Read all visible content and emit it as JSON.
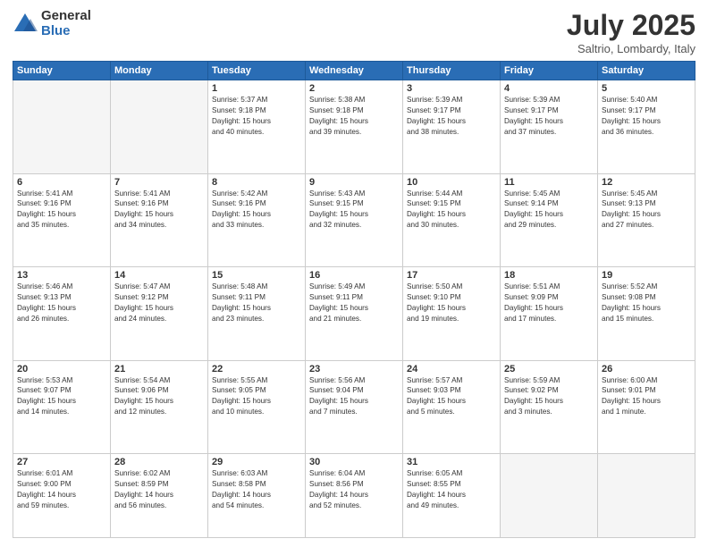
{
  "header": {
    "logo_general": "General",
    "logo_blue": "Blue",
    "month_title": "July 2025",
    "location": "Saltrio, Lombardy, Italy"
  },
  "days_of_week": [
    "Sunday",
    "Monday",
    "Tuesday",
    "Wednesday",
    "Thursday",
    "Friday",
    "Saturday"
  ],
  "weeks": [
    [
      {
        "day": "",
        "info": ""
      },
      {
        "day": "",
        "info": ""
      },
      {
        "day": "1",
        "info": "Sunrise: 5:37 AM\nSunset: 9:18 PM\nDaylight: 15 hours\nand 40 minutes."
      },
      {
        "day": "2",
        "info": "Sunrise: 5:38 AM\nSunset: 9:18 PM\nDaylight: 15 hours\nand 39 minutes."
      },
      {
        "day": "3",
        "info": "Sunrise: 5:39 AM\nSunset: 9:17 PM\nDaylight: 15 hours\nand 38 minutes."
      },
      {
        "day": "4",
        "info": "Sunrise: 5:39 AM\nSunset: 9:17 PM\nDaylight: 15 hours\nand 37 minutes."
      },
      {
        "day": "5",
        "info": "Sunrise: 5:40 AM\nSunset: 9:17 PM\nDaylight: 15 hours\nand 36 minutes."
      }
    ],
    [
      {
        "day": "6",
        "info": "Sunrise: 5:41 AM\nSunset: 9:16 PM\nDaylight: 15 hours\nand 35 minutes."
      },
      {
        "day": "7",
        "info": "Sunrise: 5:41 AM\nSunset: 9:16 PM\nDaylight: 15 hours\nand 34 minutes."
      },
      {
        "day": "8",
        "info": "Sunrise: 5:42 AM\nSunset: 9:16 PM\nDaylight: 15 hours\nand 33 minutes."
      },
      {
        "day": "9",
        "info": "Sunrise: 5:43 AM\nSunset: 9:15 PM\nDaylight: 15 hours\nand 32 minutes."
      },
      {
        "day": "10",
        "info": "Sunrise: 5:44 AM\nSunset: 9:15 PM\nDaylight: 15 hours\nand 30 minutes."
      },
      {
        "day": "11",
        "info": "Sunrise: 5:45 AM\nSunset: 9:14 PM\nDaylight: 15 hours\nand 29 minutes."
      },
      {
        "day": "12",
        "info": "Sunrise: 5:45 AM\nSunset: 9:13 PM\nDaylight: 15 hours\nand 27 minutes."
      }
    ],
    [
      {
        "day": "13",
        "info": "Sunrise: 5:46 AM\nSunset: 9:13 PM\nDaylight: 15 hours\nand 26 minutes."
      },
      {
        "day": "14",
        "info": "Sunrise: 5:47 AM\nSunset: 9:12 PM\nDaylight: 15 hours\nand 24 minutes."
      },
      {
        "day": "15",
        "info": "Sunrise: 5:48 AM\nSunset: 9:11 PM\nDaylight: 15 hours\nand 23 minutes."
      },
      {
        "day": "16",
        "info": "Sunrise: 5:49 AM\nSunset: 9:11 PM\nDaylight: 15 hours\nand 21 minutes."
      },
      {
        "day": "17",
        "info": "Sunrise: 5:50 AM\nSunset: 9:10 PM\nDaylight: 15 hours\nand 19 minutes."
      },
      {
        "day": "18",
        "info": "Sunrise: 5:51 AM\nSunset: 9:09 PM\nDaylight: 15 hours\nand 17 minutes."
      },
      {
        "day": "19",
        "info": "Sunrise: 5:52 AM\nSunset: 9:08 PM\nDaylight: 15 hours\nand 15 minutes."
      }
    ],
    [
      {
        "day": "20",
        "info": "Sunrise: 5:53 AM\nSunset: 9:07 PM\nDaylight: 15 hours\nand 14 minutes."
      },
      {
        "day": "21",
        "info": "Sunrise: 5:54 AM\nSunset: 9:06 PM\nDaylight: 15 hours\nand 12 minutes."
      },
      {
        "day": "22",
        "info": "Sunrise: 5:55 AM\nSunset: 9:05 PM\nDaylight: 15 hours\nand 10 minutes."
      },
      {
        "day": "23",
        "info": "Sunrise: 5:56 AM\nSunset: 9:04 PM\nDaylight: 15 hours\nand 7 minutes."
      },
      {
        "day": "24",
        "info": "Sunrise: 5:57 AM\nSunset: 9:03 PM\nDaylight: 15 hours\nand 5 minutes."
      },
      {
        "day": "25",
        "info": "Sunrise: 5:59 AM\nSunset: 9:02 PM\nDaylight: 15 hours\nand 3 minutes."
      },
      {
        "day": "26",
        "info": "Sunrise: 6:00 AM\nSunset: 9:01 PM\nDaylight: 15 hours\nand 1 minute."
      }
    ],
    [
      {
        "day": "27",
        "info": "Sunrise: 6:01 AM\nSunset: 9:00 PM\nDaylight: 14 hours\nand 59 minutes."
      },
      {
        "day": "28",
        "info": "Sunrise: 6:02 AM\nSunset: 8:59 PM\nDaylight: 14 hours\nand 56 minutes."
      },
      {
        "day": "29",
        "info": "Sunrise: 6:03 AM\nSunset: 8:58 PM\nDaylight: 14 hours\nand 54 minutes."
      },
      {
        "day": "30",
        "info": "Sunrise: 6:04 AM\nSunset: 8:56 PM\nDaylight: 14 hours\nand 52 minutes."
      },
      {
        "day": "31",
        "info": "Sunrise: 6:05 AM\nSunset: 8:55 PM\nDaylight: 14 hours\nand 49 minutes."
      },
      {
        "day": "",
        "info": ""
      },
      {
        "day": "",
        "info": ""
      }
    ]
  ]
}
